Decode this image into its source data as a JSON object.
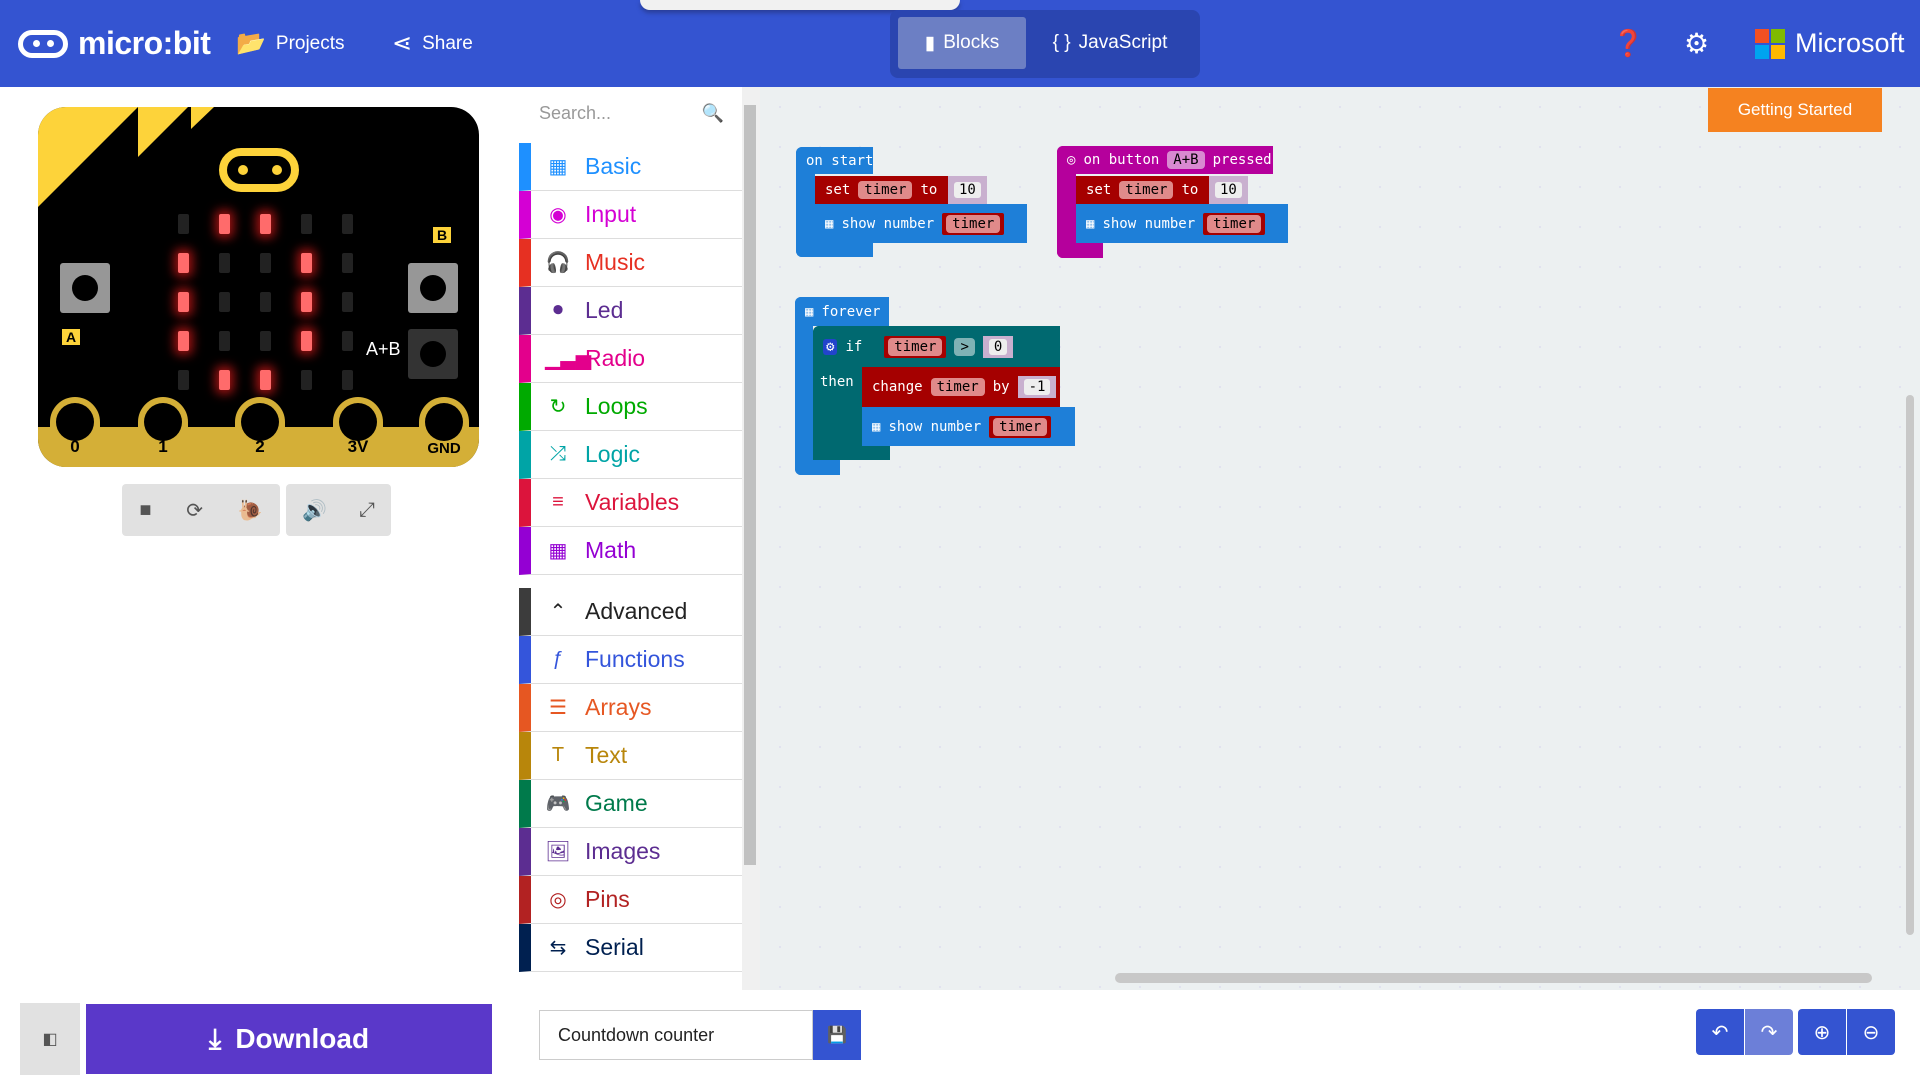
{
  "header": {
    "brand": "micro:bit",
    "projects": "Projects",
    "share": "Share",
    "modes": [
      "Blocks",
      "JavaScript"
    ],
    "active_mode": "Blocks",
    "microsoft": "Microsoft",
    "accent": "#3454d1"
  },
  "simulator": {
    "pins": [
      "0",
      "1",
      "2",
      "3V",
      "GND"
    ],
    "buttons": [
      "A",
      "B",
      "A+B"
    ],
    "leds": [
      [
        0,
        1,
        1,
        0,
        0
      ],
      [
        1,
        0,
        0,
        1,
        0
      ],
      [
        1,
        0,
        0,
        1,
        0
      ],
      [
        1,
        0,
        0,
        1,
        0
      ],
      [
        0,
        1,
        1,
        0,
        0
      ]
    ],
    "controls": [
      "stop-icon",
      "restart-icon",
      "slow-mo-icon",
      "mute-icon",
      "fullscreen-icon"
    ]
  },
  "toolbox": {
    "search_placeholder": "Search...",
    "categories": [
      {
        "label": "Basic",
        "color": "#1e90ff",
        "icon": "▦"
      },
      {
        "label": "Input",
        "color": "#d400d4",
        "icon": "◉"
      },
      {
        "label": "Music",
        "color": "#e63022",
        "icon": "🎧"
      },
      {
        "label": "Led",
        "color": "#5c2d91",
        "icon": "⏺"
      },
      {
        "label": "Radio",
        "color": "#e3008c",
        "icon": "▁▃▅"
      },
      {
        "label": "Loops",
        "color": "#00aa00",
        "icon": "↻"
      },
      {
        "label": "Logic",
        "color": "#00a4a6",
        "icon": "⤮"
      },
      {
        "label": "Variables",
        "color": "#dc143c",
        "icon": "≡"
      },
      {
        "label": "Math",
        "color": "#9400d3",
        "icon": "▦"
      },
      {
        "label": "Advanced",
        "color": "#3c3c3c",
        "icon": "⌃"
      },
      {
        "label": "Functions",
        "color": "#3455db",
        "icon": "ƒ"
      },
      {
        "label": "Arrays",
        "color": "#e65722",
        "icon": "☰"
      },
      {
        "label": "Text",
        "color": "#b8860b",
        "icon": "T"
      },
      {
        "label": "Game",
        "color": "#007a4b",
        "icon": "🎮"
      },
      {
        "label": "Images",
        "color": "#5c2d91",
        "icon": "🖼"
      },
      {
        "label": "Pins",
        "color": "#b22222",
        "icon": "◎"
      },
      {
        "label": "Serial",
        "color": "#002050",
        "icon": "⇆"
      }
    ]
  },
  "workspace": {
    "getting_started": "Getting Started",
    "on_start": {
      "hat": "on start",
      "set": "set",
      "var": "timer",
      "to": "to",
      "value": "10",
      "show": "show number",
      "show_var": "timer"
    },
    "on_button": {
      "hat_pre": "on button",
      "button": "A+B",
      "hat_post": "pressed",
      "set": "set",
      "var": "timer",
      "to": "to",
      "value": "10",
      "show": "show number",
      "show_var": "timer"
    },
    "forever": {
      "hat": "forever",
      "if": "if",
      "then": "then",
      "cond_var": "timer",
      "op": ">",
      "cond_val": "0",
      "change": "change",
      "change_var": "timer",
      "by": "by",
      "change_val": "-1",
      "show": "show number",
      "show_var": "timer"
    }
  },
  "footer": {
    "download": "Download",
    "project_name": "Countdown counter"
  }
}
